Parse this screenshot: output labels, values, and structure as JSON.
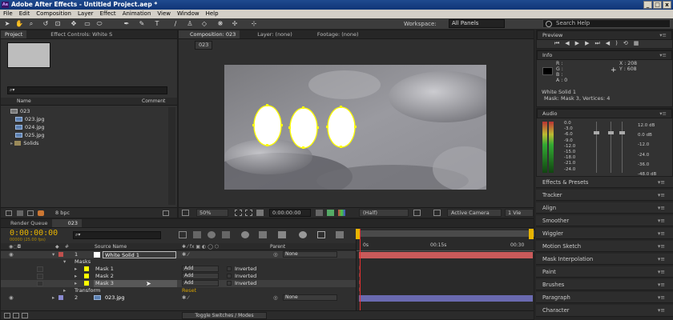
{
  "window": {
    "title": "Adobe After Effects - Untitled Project.aep *",
    "logo": "Ae",
    "controls": [
      "_",
      "□",
      "x"
    ]
  },
  "menu": [
    "File",
    "Edit",
    "Composition",
    "Layer",
    "Effect",
    "Animation",
    "View",
    "Window",
    "Help"
  ],
  "toolbar": {
    "workspace_label": "Workspace:",
    "workspace_value": "All Panels",
    "search_placeholder": "Search Help"
  },
  "project_panel": {
    "tabs": [
      "Project",
      "Effect Controls: White S"
    ],
    "search_placeholder": "",
    "columns": [
      "Name",
      "Comment"
    ],
    "items": [
      {
        "name": "023",
        "kind": "comp"
      },
      {
        "name": "023.jpg",
        "kind": "file"
      },
      {
        "name": "024.jpg",
        "kind": "file"
      },
      {
        "name": "025.jpg",
        "kind": "file"
      },
      {
        "name": "Solids",
        "kind": "folder"
      }
    ],
    "bpc": "8 bpc"
  },
  "comp_panel": {
    "tabs": [
      "Composition: 023",
      "Layer: (none)",
      "Footage: (none)"
    ],
    "comp_tag": "023",
    "zoom": "50%",
    "timecode": "0:00:00:00",
    "resolution": "(Half)",
    "camera": "Active Camera",
    "views": "1 Vie"
  },
  "timeline": {
    "tabs": [
      "Render Queue",
      "023"
    ],
    "timecode": "0:00:00:00",
    "frames": "00000 (25.00 fps)",
    "col_source": "Source Name",
    "col_parent": "Parent",
    "ruler": [
      "0s",
      "00:15s",
      "00:30"
    ],
    "layers": [
      {
        "num": "1",
        "name": "White Solid 1",
        "parent": "None",
        "selected": true
      },
      {
        "num": "2",
        "name": "023.jpg",
        "parent": "None",
        "selected": false
      }
    ],
    "masks_group": "Masks",
    "masks": [
      {
        "name": "Mask 1",
        "mode": "Add",
        "inverted": "Inverted"
      },
      {
        "name": "Mask 2",
        "mode": "Add",
        "inverted": "Inverted"
      },
      {
        "name": "Mask 3",
        "mode": "Add",
        "inverted": "Inverted"
      }
    ],
    "transform": "Transform",
    "reset": "Reset",
    "footer_button": "Toggle Switches / Modes"
  },
  "right_panels": {
    "preview": "Preview",
    "info": "Info",
    "info_values": {
      "r": "R :",
      "g": "G :",
      "b": "B :",
      "a": "A : 0",
      "x": "X : 208",
      "y": "Y : 608",
      "layer": "White Solid 1",
      "detail": "Mask: Mask 3, Vertices: 4"
    },
    "audio": "Audio",
    "audio_left": [
      "0.0",
      "-3.0",
      "-6.0",
      "-9.0",
      "-12.0",
      "-15.0",
      "-18.0",
      "-21.0",
      "-24.0"
    ],
    "audio_right": [
      "12.0 dB",
      "0.0 dB",
      "-12.0",
      "-24.0",
      "-36.0",
      "-48.0 dB"
    ],
    "stack": [
      "Effects & Presets",
      "Tracker",
      "Align",
      "Smoother",
      "Wiggler",
      "Motion Sketch",
      "Mask Interpolation",
      "Paint",
      "Brushes",
      "Paragraph",
      "Character"
    ]
  },
  "colors": {
    "accent_timecode": "#e8b400",
    "mask_yellow": "#ffff00",
    "layer_bar_red": "#c85a5a",
    "layer_bar_blue": "#6a6ab0"
  }
}
